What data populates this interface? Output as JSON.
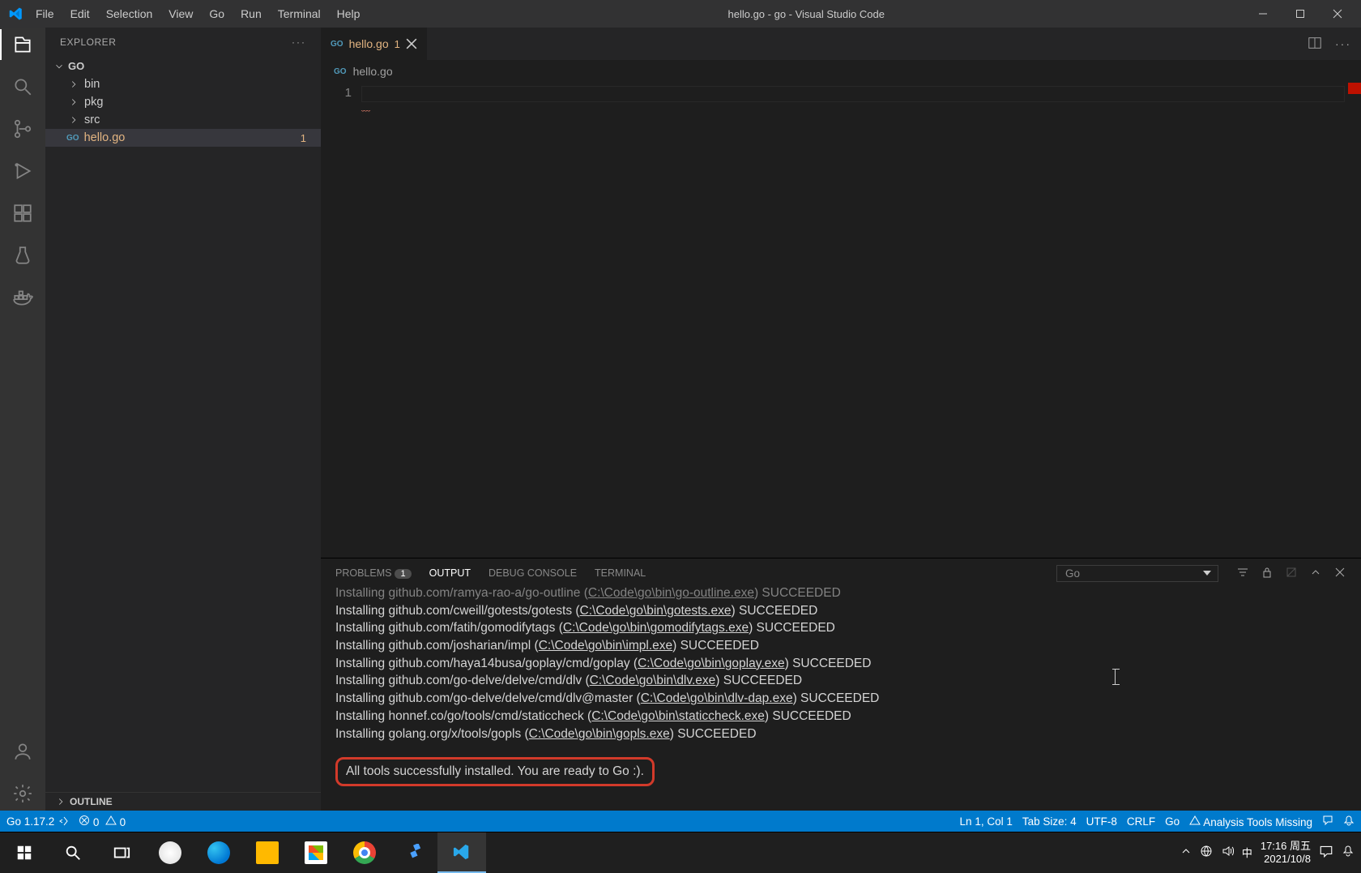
{
  "titlebar": {
    "menu": [
      "File",
      "Edit",
      "Selection",
      "View",
      "Go",
      "Run",
      "Terminal",
      "Help"
    ],
    "title": "hello.go - go - Visual Studio Code"
  },
  "sidebar": {
    "header": "EXPLORER",
    "root": "GO",
    "folders": [
      "bin",
      "pkg",
      "src"
    ],
    "file": {
      "name": "hello.go",
      "problems": "1"
    },
    "outline": "OUTLINE"
  },
  "tabs": {
    "tab1": "hello.go",
    "tab1mod": "1"
  },
  "breadcrumb": "hello.go",
  "gutter": {
    "line1": "1"
  },
  "panel": {
    "tabs": {
      "problems": "PROBLEMS",
      "problems_badge": "1",
      "output": "OUTPUT",
      "debug": "DEBUG CONSOLE",
      "terminal": "TERMINAL"
    },
    "channel": "Go",
    "lines": [
      {
        "pre": "Installing github.com/ramya-rao-a/go-outline (",
        "path": "C:\\Code\\go\\bin\\go-outline.exe",
        "post": ") SUCCEEDED"
      },
      {
        "pre": "Installing github.com/cweill/gotests/gotests (",
        "path": "C:\\Code\\go\\bin\\gotests.exe",
        "post": ") SUCCEEDED"
      },
      {
        "pre": "Installing github.com/fatih/gomodifytags (",
        "path": "C:\\Code\\go\\bin\\gomodifytags.exe",
        "post": ") SUCCEEDED"
      },
      {
        "pre": "Installing github.com/josharian/impl (",
        "path": "C:\\Code\\go\\bin\\impl.exe",
        "post": ") SUCCEEDED"
      },
      {
        "pre": "Installing github.com/haya14busa/goplay/cmd/goplay (",
        "path": "C:\\Code\\go\\bin\\goplay.exe",
        "post": ") SUCCEEDED"
      },
      {
        "pre": "Installing github.com/go-delve/delve/cmd/dlv (",
        "path": "C:\\Code\\go\\bin\\dlv.exe",
        "post": ") SUCCEEDED"
      },
      {
        "pre": "Installing github.com/go-delve/delve/cmd/dlv@master (",
        "path": "C:\\Code\\go\\bin\\dlv-dap.exe",
        "post": ") SUCCEEDED"
      },
      {
        "pre": "Installing honnef.co/go/tools/cmd/staticcheck (",
        "path": "C:\\Code\\go\\bin\\staticcheck.exe",
        "post": ") SUCCEEDED"
      },
      {
        "pre": "Installing golang.org/x/tools/gopls (",
        "path": "C:\\Code\\go\\bin\\gopls.exe",
        "post": ") SUCCEEDED"
      }
    ],
    "success": "All tools successfully installed. You are ready to Go :)."
  },
  "status": {
    "go": "Go 1.17.2",
    "err": "0",
    "warn": "0",
    "ln": "Ln 1, Col 1",
    "tab": "Tab Size: 4",
    "enc": "UTF-8",
    "eol": "CRLF",
    "lang": "Go",
    "analysis": "Analysis Tools Missing"
  },
  "tray": {
    "ime": "中",
    "time": "17:16 周五",
    "date": "2021/10/8"
  }
}
